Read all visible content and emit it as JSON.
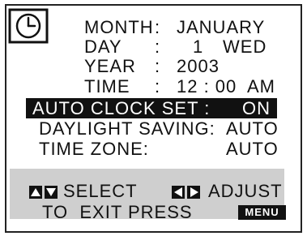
{
  "settings": {
    "month_label": "MONTH",
    "month_sep": ":",
    "month_value": "JANUARY",
    "day_label": "DAY",
    "day_sep": ":",
    "day_value": "1",
    "day_weekday": "WED",
    "year_label": "YEAR",
    "year_sep": ":",
    "year_value": "2003",
    "time_label": "TIME",
    "time_sep": ":",
    "time_value": "12 : 00",
    "time_ampm": "AM"
  },
  "menu": {
    "auto_clock_label": "AUTO CLOCK SET :",
    "auto_clock_value": "ON",
    "daylight_label": "DAYLIGHT SAVING:",
    "daylight_value": "AUTO",
    "timezone_label": "TIME ZONE:",
    "timezone_value": "AUTO"
  },
  "help": {
    "select_label": "SELECT",
    "adjust_label": "ADJUST",
    "exit_text": "TO  EXIT PRESS",
    "menu_key": "MENU"
  },
  "colors": {
    "highlight_bg": "#111111",
    "footer_bg": "#cfcfcf"
  },
  "icons": {
    "clock": "clock-icon",
    "up_down": "up-down-arrows-icon",
    "left_right": "left-right-arrows-icon"
  }
}
